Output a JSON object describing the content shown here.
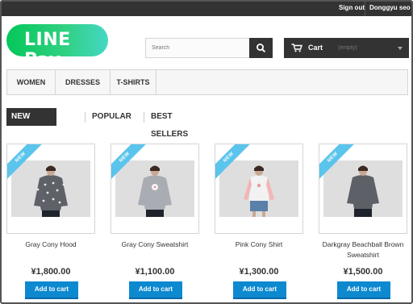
{
  "topbar": {
    "sign_out": "Sign out",
    "user_name": "Donggyu seo"
  },
  "brand": {
    "logo_text": "LINE Pay",
    "logo_colors": [
      "#04c75a",
      "#45d7c4"
    ]
  },
  "search": {
    "placeholder": "Search",
    "icon": "search-icon"
  },
  "cart": {
    "label": "Cart",
    "status": "(empty)",
    "icon": "shopping-cart-icon"
  },
  "menu": {
    "items": [
      "WOMEN",
      "DRESSES",
      "T-SHIRTS"
    ]
  },
  "tabs": {
    "items": [
      "NEW ARRIVALS",
      "POPULAR",
      "BEST SELLERS"
    ],
    "active": "NEW ARRIVALS"
  },
  "products": [
    {
      "badge": "NEW",
      "name": "Gray Cony Hood",
      "price": "¥1,800.00",
      "button": "Add to cart"
    },
    {
      "badge": "NEW",
      "name": "Gray Cony Sweatshirt",
      "price": "¥1,100.00",
      "button": "Add to cart"
    },
    {
      "badge": "NEW",
      "name": "Pink Cony Shirt",
      "price": "¥1,300.00",
      "button": "Add to cart"
    },
    {
      "badge": "NEW",
      "name": "Darkgray Beachball Brown Sweatshirt",
      "price": "¥1,500.00",
      "button": "Add to cart"
    }
  ],
  "colors": {
    "dark": "#333333",
    "accent_blue": "#0d89d0",
    "ribbon": "#5bc4ec"
  }
}
